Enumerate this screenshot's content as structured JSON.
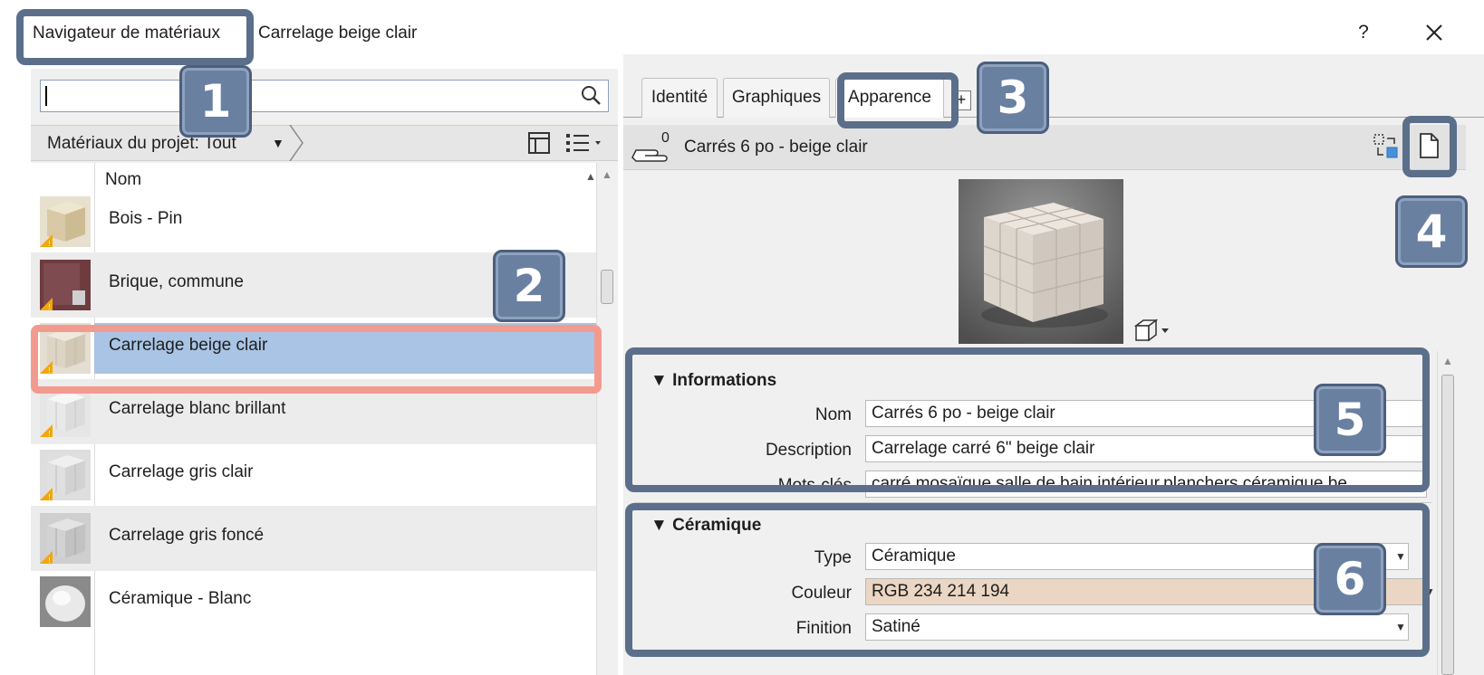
{
  "window": {
    "title": "Navigateur de matériaux",
    "subtitle": "Carrelage beige clair",
    "help_label": "?",
    "close_icon": "close-icon"
  },
  "annotations": {
    "badges": [
      "1",
      "2",
      "3",
      "4",
      "5",
      "6"
    ]
  },
  "library": {
    "search": {
      "value": "",
      "placeholder": ""
    },
    "breadcrumb": "Matériaux du projet: Tout",
    "breadcrumb_arrow": "▼",
    "column_header": "Nom",
    "items": [
      {
        "label": "Bois - Pin",
        "thumb": "wood",
        "warning": true
      },
      {
        "label": "Brique, commune",
        "thumb": "brick",
        "warning": true
      },
      {
        "label": "Carrelage beige clair",
        "thumb": "tile-beige",
        "warning": true,
        "selected": true
      },
      {
        "label": "Carrelage blanc brillant",
        "thumb": "tile-white",
        "warning": true
      },
      {
        "label": "Carrelage gris clair",
        "thumb": "tile-grey-light",
        "warning": true
      },
      {
        "label": "Carrelage gris foncé",
        "thumb": "tile-grey-dark",
        "warning": true
      },
      {
        "label": "Céramique - Blanc",
        "thumb": "ceramic",
        "warning": false
      }
    ]
  },
  "editor": {
    "tabs": [
      "Identité",
      "Graphiques",
      "Apparence"
    ],
    "active_tab": "Apparence",
    "add_tab_label": "+",
    "asset": {
      "users_count": "0",
      "name": "Carrés 6 po - beige clair"
    },
    "informations": {
      "title": "Informations",
      "fields": [
        {
          "label": "Nom",
          "value": "Carrés 6 po - beige clair"
        },
        {
          "label": "Description",
          "value": "Carrelage carré 6\" beige clair"
        },
        {
          "label": "Mots-clés",
          "value": "carré,mosaïque,salle de bain,intérieur,planchers,céramique,be..."
        }
      ]
    },
    "ceramique": {
      "title": "Céramique",
      "fields": [
        {
          "label": "Type",
          "value": "Céramique"
        },
        {
          "label": "Couleur",
          "value": "RGB 234 214 194",
          "swatch": "#ead6c2"
        },
        {
          "label": "Finition",
          "value": "Satiné"
        }
      ]
    }
  },
  "colors": {
    "selection": "#a9c4e4",
    "highlight": "#f39a8f",
    "callout": "#5b6f8b",
    "badge": "#6a80a1"
  }
}
